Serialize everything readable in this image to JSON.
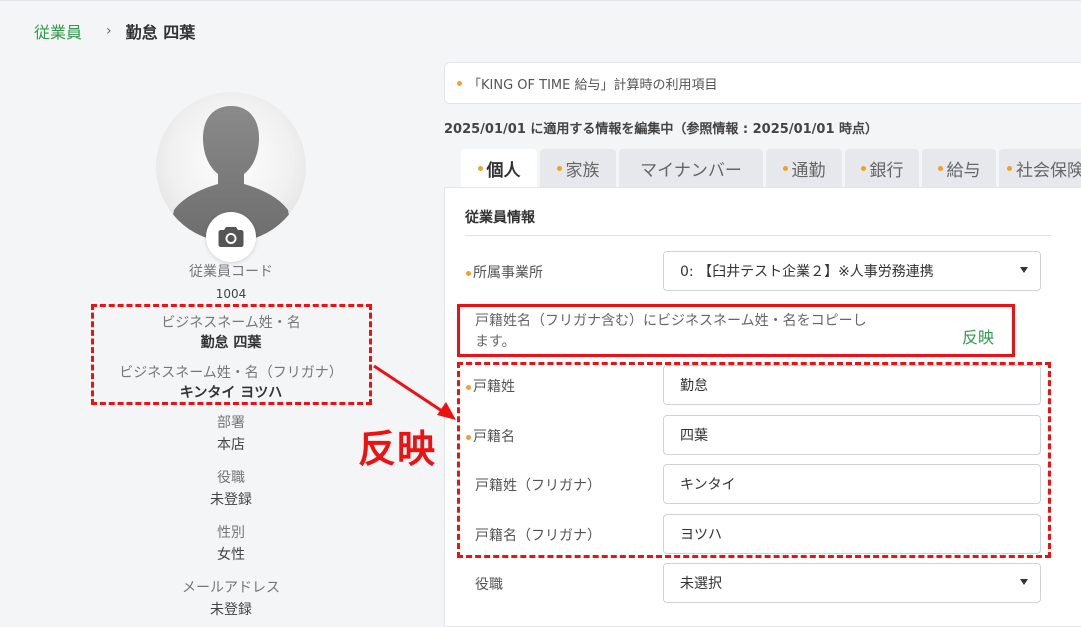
{
  "breadcrumb": {
    "parent": "従業員",
    "separator": "›",
    "current": "勤怠 四葉"
  },
  "profile": {
    "employee_code_label": "従業員コード",
    "employee_code": "1004",
    "business_name_label": "ビジネスネーム姓・名",
    "business_name": "勤怠 四葉",
    "business_kana_label": "ビジネスネーム姓・名（フリガナ）",
    "business_kana": "キンタイ ヨツハ",
    "department_label": "部署",
    "department": "本店",
    "position_label": "役職",
    "position": "未登録",
    "gender_label": "性別",
    "gender": "女性",
    "email_label": "メールアドレス",
    "email": "未登録"
  },
  "annotation": {
    "label": "反映",
    "color": "#e11111"
  },
  "notice": {
    "text": "「KING OF TIME 給与」計算時の利用項目"
  },
  "edit_info": "2025/01/01 に適用する情報を編集中（参照情報 : 2025/01/01 時点）",
  "tabs": [
    {
      "label": "個人",
      "active": true
    },
    {
      "label": "家族"
    },
    {
      "label": "マイナンバー",
      "no_dot": true
    },
    {
      "label": "通勤"
    },
    {
      "label": "銀行"
    },
    {
      "label": "給与"
    },
    {
      "label": "社会保険"
    }
  ],
  "form": {
    "section_title": "従業員情報",
    "office_label": "所属事業所",
    "office_value": "0: 【臼井テスト企業２】※人事労務連携",
    "reflect_text": "戸籍姓名（フリガナ含む）にビジネスネーム姓・名をコピーします。",
    "reflect_button": "反映",
    "family_name_label": "戸籍姓",
    "family_name_value": "勤怠",
    "given_name_label": "戸籍名",
    "given_name_value": "四葉",
    "family_kana_label": "戸籍姓（フリガナ）",
    "family_kana_value": "キンタイ",
    "given_kana_label": "戸籍名（フリガナ）",
    "given_kana_value": "ヨツハ",
    "position_label": "役職",
    "position_value": "未選択"
  },
  "colors": {
    "accent_green": "#2e9b48",
    "required_dot": "#f0a030",
    "highlight_red": "#e11111"
  },
  "icons": [
    "camera-icon",
    "chevron-right-icon",
    "caret-down-icon"
  ]
}
